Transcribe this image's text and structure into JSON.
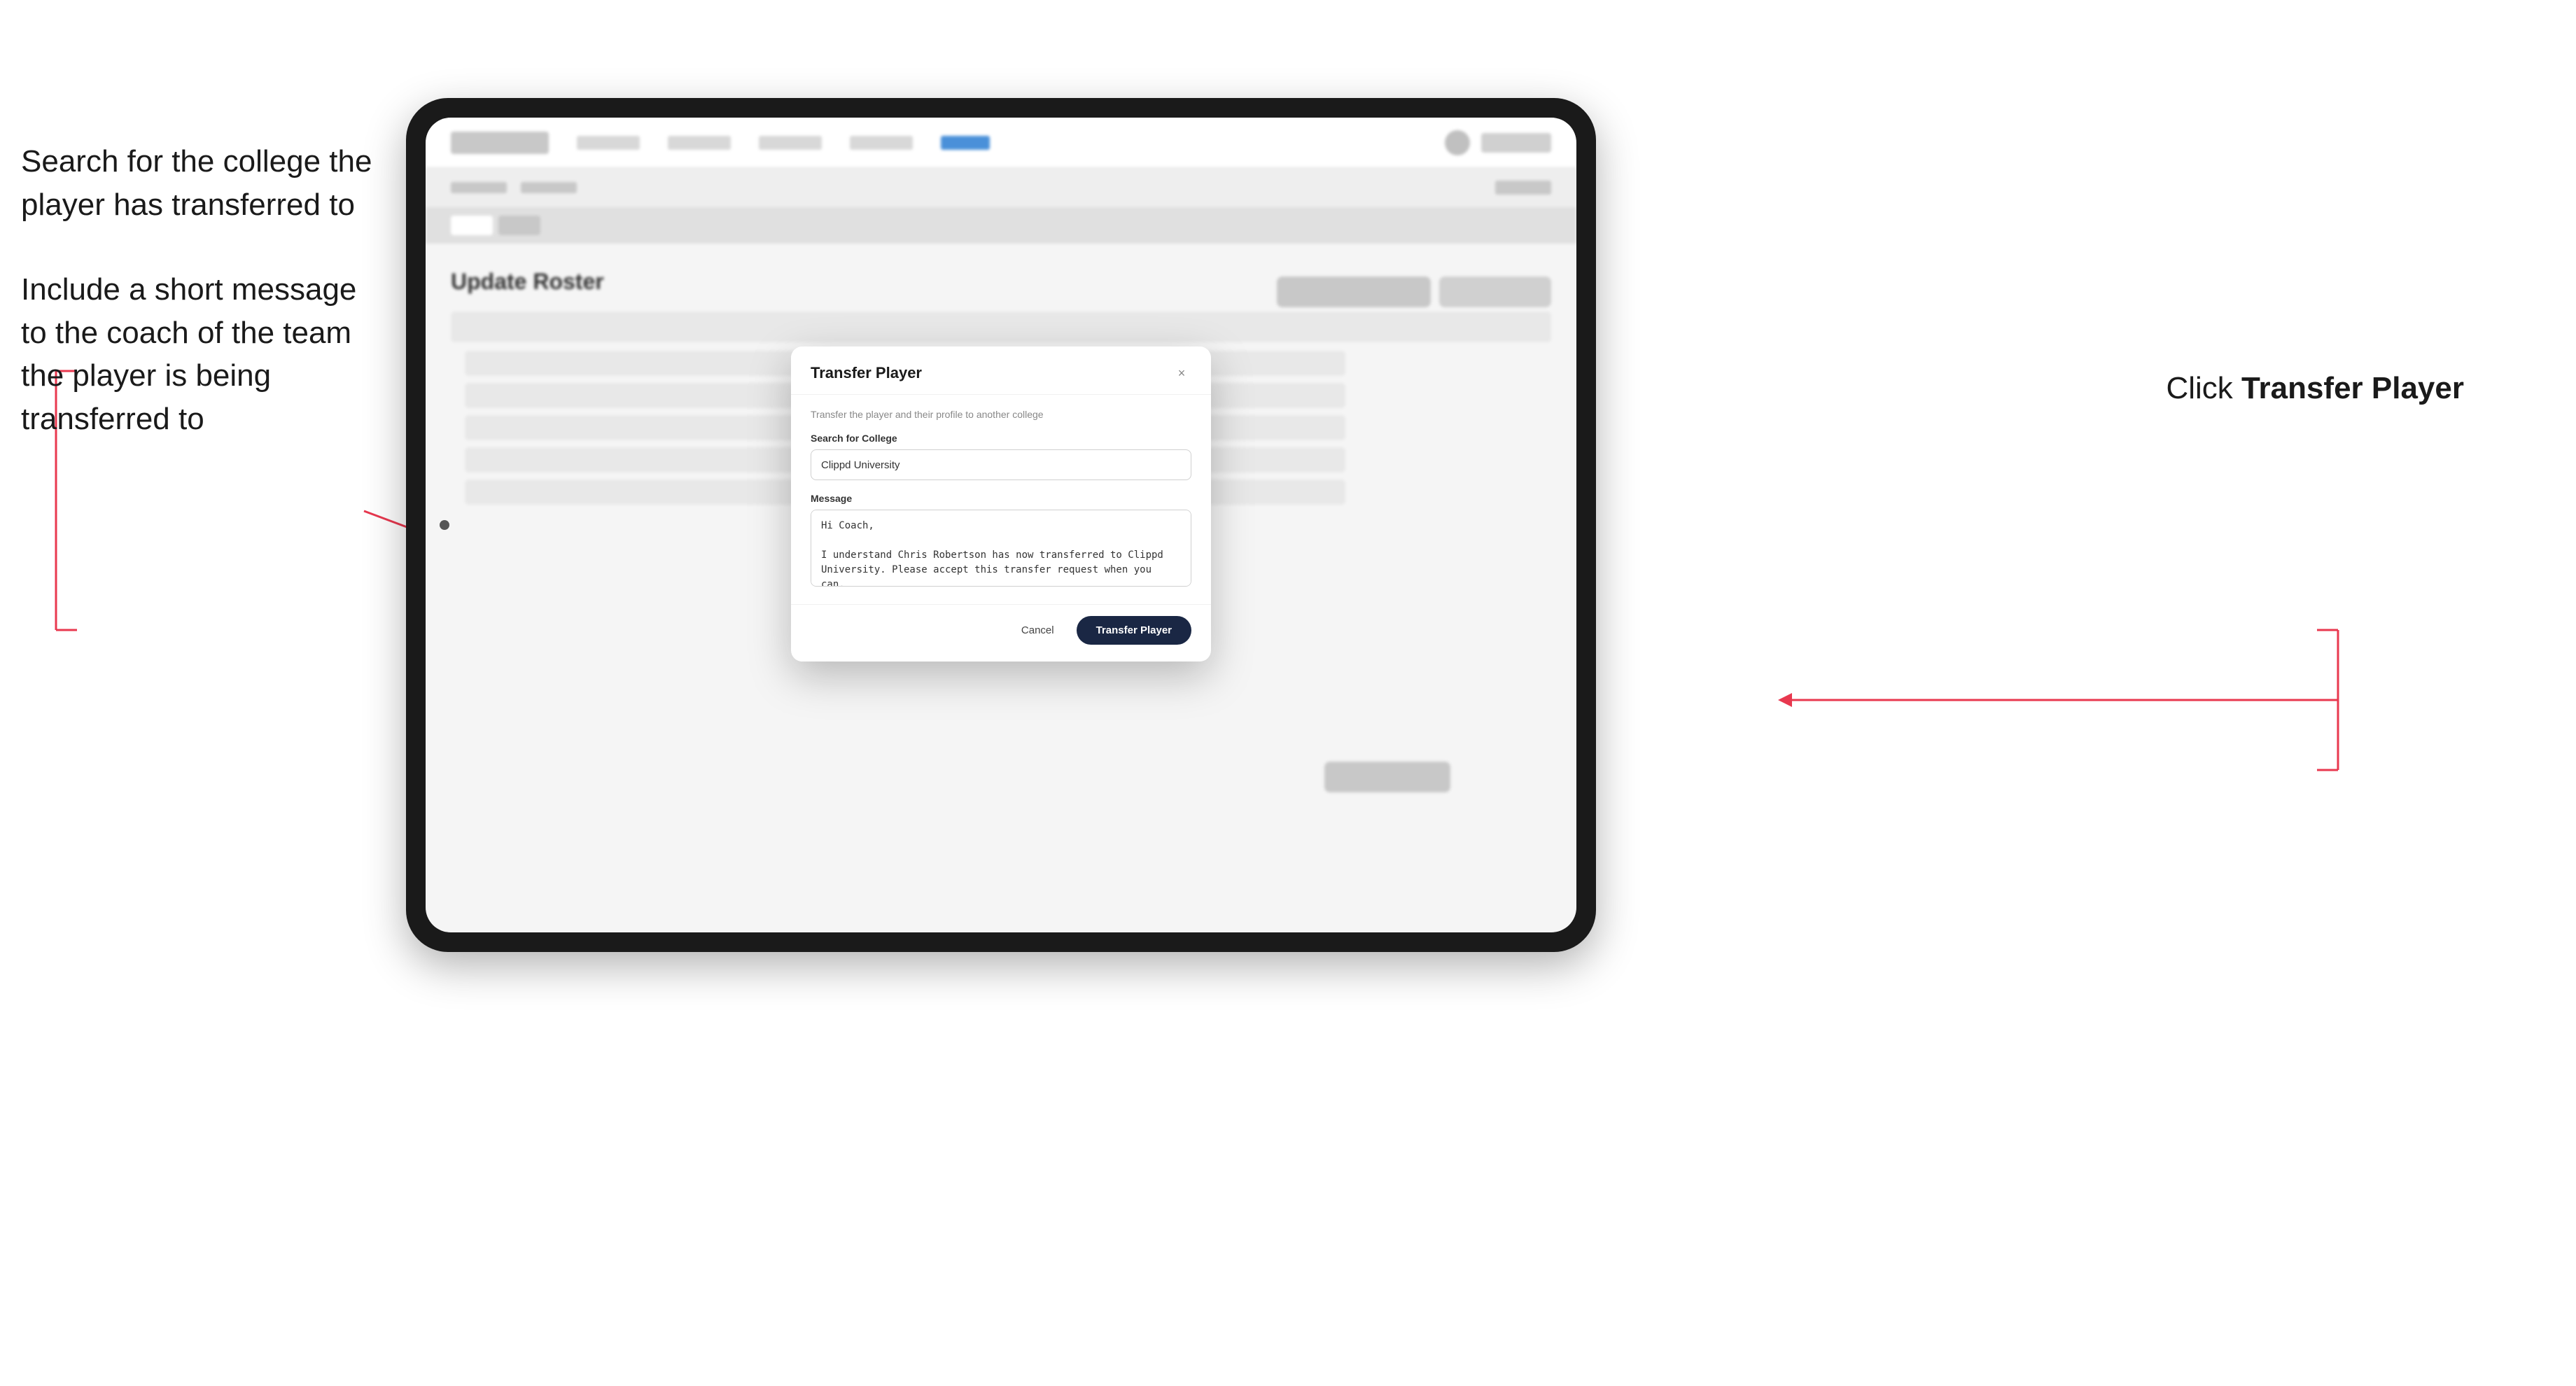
{
  "annotations": {
    "left_top": "Search for the college the player has transferred to",
    "left_bottom": "Include a short message to the coach of the team the player is being transferred to",
    "right_prefix": "Click ",
    "right_bold": "Transfer Player"
  },
  "dialog": {
    "title": "Transfer Player",
    "subtitle": "Transfer the player and their profile to another college",
    "search_label": "Search for College",
    "search_value": "Clippd University",
    "message_label": "Message",
    "message_value": "Hi Coach,\n\nI understand Chris Robertson has now transferred to Clippd University. Please accept this transfer request when you can.",
    "cancel_label": "Cancel",
    "transfer_label": "Transfer Player",
    "close_icon": "×"
  },
  "app": {
    "update_roster_title": "Update Roster"
  }
}
